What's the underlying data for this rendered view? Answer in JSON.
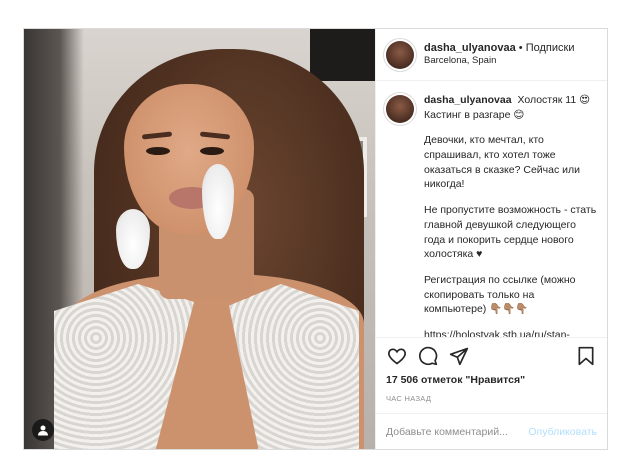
{
  "post": {
    "header": {
      "username": "dasha_ulyanovaa",
      "separator": "•",
      "follow_label": "Подписки",
      "location": "Barcelona, Spain"
    },
    "caption": {
      "username": "dasha_ulyanovaa",
      "paragraphs": [
        "Холостяк 11 😍 Кастинг в разгаре 😊",
        "Девочки, кто мечтал, кто спрашивал, кто хотел тоже оказаться в сказке? Сейчас или никогда!",
        "Не пропустите возможность - стать главной девушкой следующего года и покорить сердце нового холостяка ♥",
        "Регистрация по ссылке (можно скопировать только на компьютере) 👇🏽👇🏽👇🏽",
        "https://holostyak.stb.ua/ru/stan-uchastnitsej-realiti-shou-holostyak/",
        "-"
      ]
    },
    "likes": "17 506 отметок \"Нравится\"",
    "time": "ЧАС НАЗАД",
    "comment_placeholder": "Добавьте комментарий...",
    "publish_label": "Опубликовать",
    "icons": [
      "heart-icon",
      "comment-icon",
      "share-icon",
      "bookmark-icon",
      "user-tag-icon"
    ],
    "colors": {
      "publish_disabled": "#b2dffc",
      "border": "#dbdbdb",
      "muted": "#8e8e8e"
    }
  }
}
